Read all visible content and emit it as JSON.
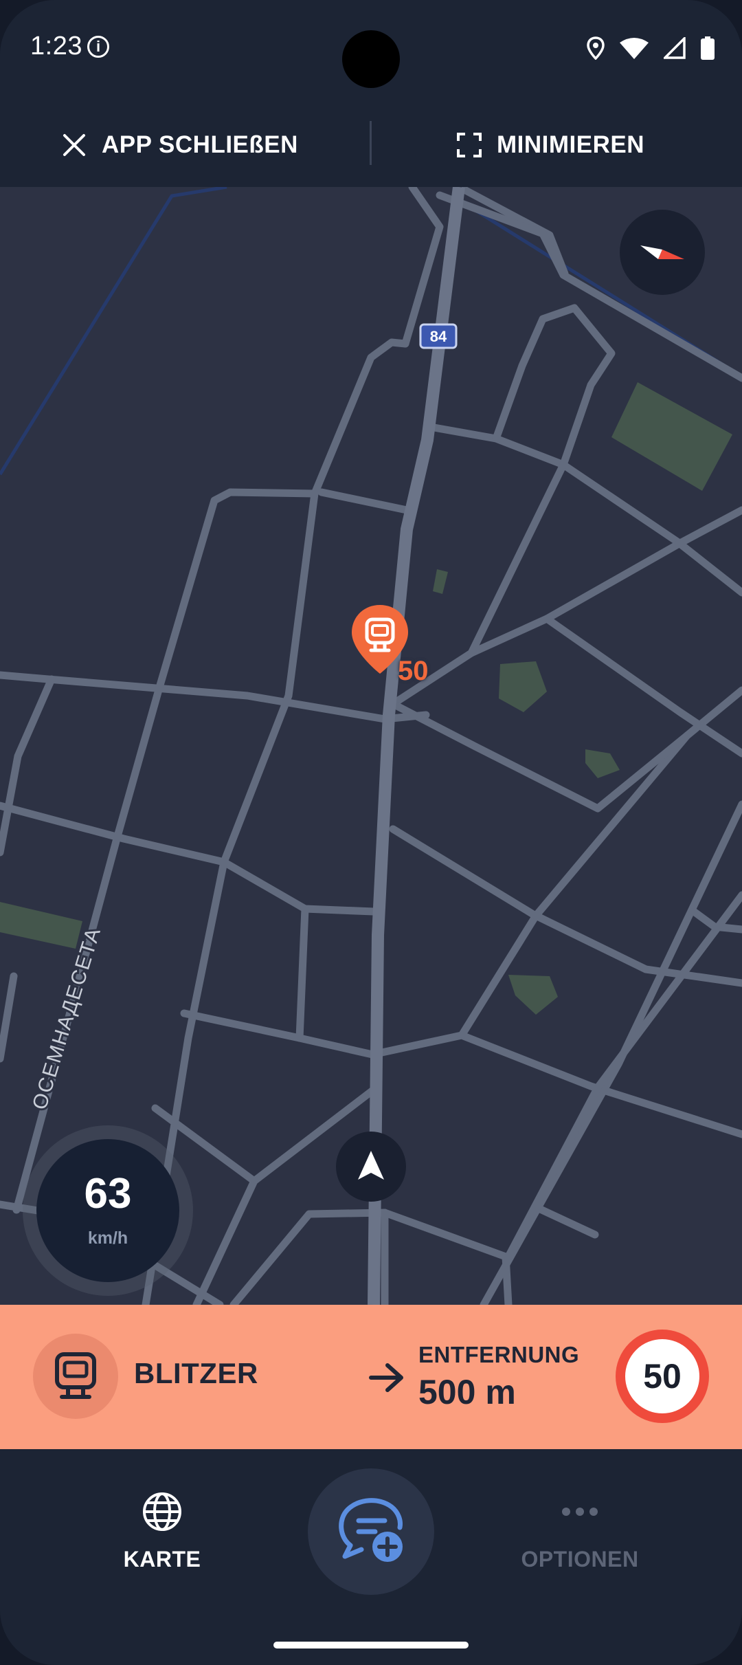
{
  "status_bar": {
    "time": "1:23",
    "info_icon": "info-icon",
    "right_icons": [
      "location-icon",
      "wifi-icon",
      "signal-icon",
      "battery-icon"
    ]
  },
  "top_bar": {
    "close_label": "APP SCHLIEßEN",
    "minimize_label": "MINIMIEREN"
  },
  "map": {
    "route_shield": "84",
    "street_label": "ОСЕМНАДЕСЕТА",
    "camera_marker_limit": "50",
    "marker_color": "#f26a3c"
  },
  "speedometer": {
    "value": "63",
    "unit": "km/h"
  },
  "alert": {
    "type_label": "BLITZER",
    "distance_label": "ENTFERNUNG",
    "distance_value": "500 m",
    "speed_limit": "50",
    "background": "#fb9e7f"
  },
  "bottom_nav": {
    "map_label": "KARTE",
    "options_label": "OPTIONEN",
    "report_icon": "chat-add-icon"
  }
}
